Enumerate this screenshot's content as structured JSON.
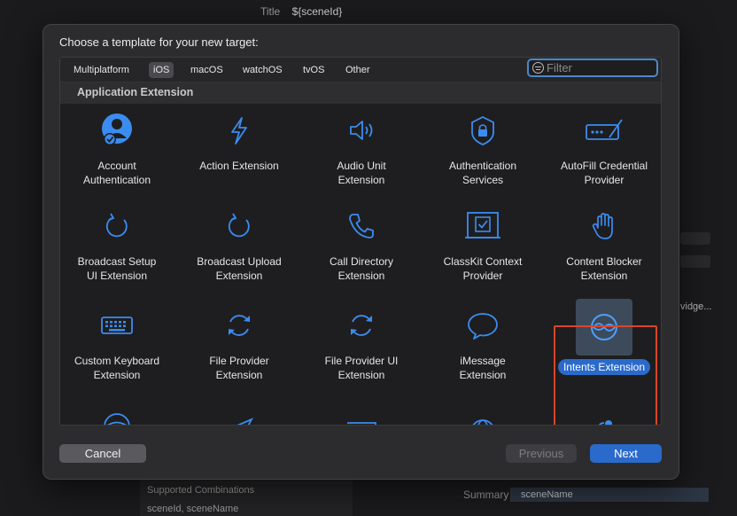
{
  "background": {
    "title_label": "Title",
    "title_value": "${sceneId}",
    "right_text": "vidge...",
    "supported_combinations": "Supported Combinations",
    "combination_value": "sceneId, sceneName",
    "summary_label": "Summary",
    "summary_value": "sceneName"
  },
  "dialog": {
    "title": "Choose a template for your new target:",
    "tabs": [
      {
        "label": "Multiplatform",
        "selected": false
      },
      {
        "label": "iOS",
        "selected": true
      },
      {
        "label": "macOS",
        "selected": false
      },
      {
        "label": "watchOS",
        "selected": false
      },
      {
        "label": "tvOS",
        "selected": false
      },
      {
        "label": "Other",
        "selected": false
      }
    ],
    "filter_placeholder": "Filter",
    "section": "Application Extension",
    "templates": [
      {
        "label": "Account\nAuthentication",
        "icon": "account-authentication-icon"
      },
      {
        "label": "Action Extension",
        "icon": "bolt-icon"
      },
      {
        "label": "Audio Unit\nExtension",
        "icon": "speaker-icon"
      },
      {
        "label": "Authentication\nServices",
        "icon": "lock-shield-icon"
      },
      {
        "label": "AutoFill Credential\nProvider",
        "icon": "password-field-icon"
      },
      {
        "label": "Broadcast Setup\nUI Extension",
        "icon": "refresh-arrow-icon"
      },
      {
        "label": "Broadcast Upload\nExtension",
        "icon": "refresh-arrow-icon"
      },
      {
        "label": "Call Directory\nExtension",
        "icon": "phone-icon"
      },
      {
        "label": "ClassKit Context\nProvider",
        "icon": "checkbox-board-icon"
      },
      {
        "label": "Content Blocker\nExtension",
        "icon": "hand-icon"
      },
      {
        "label": "Custom Keyboard\nExtension",
        "icon": "keyboard-icon"
      },
      {
        "label": "File Provider\nExtension",
        "icon": "sync-arrows-icon"
      },
      {
        "label": "File Provider UI\nExtension",
        "icon": "sync-arrows-icon"
      },
      {
        "label": "iMessage\nExtension",
        "icon": "message-bubble-icon"
      },
      {
        "label": "Intents Extension",
        "icon": "intents-icon",
        "selected": true
      }
    ],
    "buttons": {
      "cancel": "Cancel",
      "previous": "Previous",
      "next": "Next"
    }
  },
  "colors": {
    "accent": "#2a6acb",
    "icon_blue": "#3b8cf0",
    "highlight": "#d9452b"
  }
}
